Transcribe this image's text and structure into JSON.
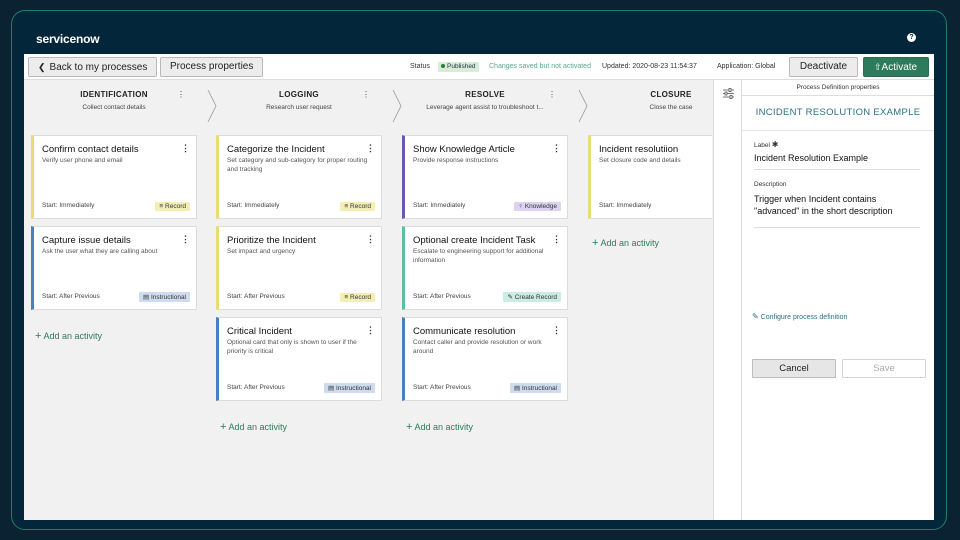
{
  "brand": {
    "logo": "servicenow"
  },
  "toolbar": {
    "back_label": "Back to my processes",
    "properties_label": "Process properties",
    "status_label": "Status",
    "status_value": "Published",
    "saved_note": "Changes saved but not activated",
    "updated": "Updated:  2020-08-23 11:54:37",
    "application": "Application: Global",
    "deactivate_label": "Deactivate",
    "activate_label": "Activate"
  },
  "stages": [
    {
      "name": "IDENTIFICATION",
      "desc": "Collect contact details",
      "add_label": "Add an activity",
      "cards": [
        {
          "title": "Confirm contact details",
          "desc": "Verify user phone and email",
          "start": "Start: Immediately",
          "tag": "Record",
          "tag_icon": "list-icon",
          "color": "#e9dc77"
        },
        {
          "title": "Capture issue details",
          "desc": "Ask the user what they are calling about",
          "start": "Start: After Previous",
          "tag": "Instructional",
          "tag_icon": "doc-icon",
          "color": "#4a7fc1"
        }
      ]
    },
    {
      "name": "LOGGING",
      "desc": "Research user request",
      "add_label": "Add an activity",
      "cards": [
        {
          "title": "Categorize the Incident",
          "desc": "Set category and sub-category for proper routing and tracking",
          "start": "Start: Immediately",
          "tag": "Record",
          "tag_icon": "list-icon",
          "color": "#e9dc77"
        },
        {
          "title": "Prioritize the Incident",
          "desc": "Set impact and urgency",
          "start": "Start: After Previous",
          "tag": "Record",
          "tag_icon": "list-icon",
          "color": "#e9dc77"
        },
        {
          "title": "Critical Incident",
          "desc": "Optional card that only is shown to user if the priority is critical",
          "start": "Start: After Previous",
          "tag": "Instructional",
          "tag_icon": "doc-icon",
          "color": "#4a7fc1"
        }
      ]
    },
    {
      "name": "RESOLVE",
      "desc": "Leverage agent assist to troubleshoot t...",
      "add_label": "Add an activity",
      "cards": [
        {
          "title": "Show Knowledge Article",
          "desc": "Provide response instructions",
          "start": "Start: Immediately",
          "tag": "Knowledge",
          "tag_icon": "bulb-icon",
          "color": "#6a57b8"
        },
        {
          "title": "Optional create Incident Task",
          "desc": "Escalate to engineering support for additional information",
          "start": "Start: After Previous",
          "tag": "Create Record",
          "tag_icon": "pencil-icon",
          "color": "#5cbfa3"
        },
        {
          "title": "Communicate resolution",
          "desc": "Contact caller and provide resolution or work around",
          "start": "Start: After Previous",
          "tag": "Instructional",
          "tag_icon": "doc-icon",
          "color": "#4a7fc1"
        }
      ]
    },
    {
      "name": "CLOSURE",
      "desc": "Close the case",
      "add_label": "Add an activity",
      "cards": [
        {
          "title": "Incident resolutiion",
          "desc": "Set closure code and details",
          "start": "Start: Immediately",
          "tag": "",
          "tag_icon": "",
          "color": "#e9dc77"
        }
      ]
    }
  ],
  "panel": {
    "header": "Process Definition properties",
    "title": "INCIDENT RESOLUTION EXAMPLE",
    "label_caption": "Label",
    "label_value": "Incident Resolution Example",
    "desc_caption": "Description",
    "desc_value": "Trigger when Incident contains \"advanced\" in the short description",
    "configure_link": "Configure process definition",
    "cancel_label": "Cancel",
    "save_label": "Save"
  }
}
